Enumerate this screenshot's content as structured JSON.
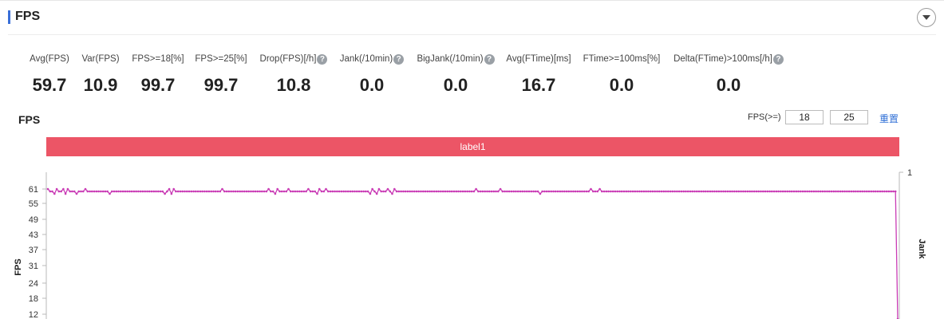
{
  "section": {
    "title": "FPS"
  },
  "stats": [
    {
      "label": "Avg(FPS)",
      "value": "59.7",
      "help": false
    },
    {
      "label": "Var(FPS)",
      "value": "10.9",
      "help": false
    },
    {
      "label": "FPS>=18[%]",
      "value": "99.7",
      "help": false
    },
    {
      "label": "FPS>=25[%]",
      "value": "99.7",
      "help": false
    },
    {
      "label": "Drop(FPS)[/h]",
      "value": "10.8",
      "help": true
    },
    {
      "label": "Jank(/10min)",
      "value": "0.0",
      "help": true
    },
    {
      "label": "BigJank(/10min)",
      "value": "0.0",
      "help": true
    },
    {
      "label": "Avg(FTime)[ms]",
      "value": "16.7",
      "help": false
    },
    {
      "label": "FTime>=100ms[%]",
      "value": "0.0",
      "help": false
    },
    {
      "label": "Delta(FTime)>100ms[/h]",
      "value": "0.0",
      "help": true
    }
  ],
  "help_glyph": "?",
  "chart_panel": {
    "title": "FPS",
    "threshold_label": "FPS(>=)",
    "threshold_low": "18",
    "threshold_high": "25",
    "reset_label": "重置",
    "label_bar_text": "label1",
    "label_bar_color": "#ec5566"
  },
  "chart_data": {
    "type": "line",
    "ylabel": "FPS",
    "y2label": "Jank",
    "y_ticks": [
      "61",
      "55",
      "49",
      "43",
      "37",
      "31",
      "24",
      "18",
      "12"
    ],
    "y2_ticks": [
      "1"
    ],
    "series": [
      {
        "name": "FPS",
        "color": "#c93bb5",
        "values": [
          61,
          60,
          60,
          59,
          61,
          60,
          60,
          61,
          59,
          61,
          60,
          60,
          60,
          59,
          60,
          60,
          60,
          61,
          60,
          60,
          60,
          60,
          60,
          60,
          60,
          60,
          60,
          60,
          59,
          60,
          60,
          60,
          60,
          60,
          60,
          60,
          60,
          60,
          60,
          60,
          60,
          60,
          60,
          60,
          60,
          60,
          60,
          60,
          60,
          60,
          60,
          60,
          60,
          59,
          60,
          61,
          59,
          61,
          60,
          60,
          60,
          60,
          60,
          60,
          60,
          60,
          60,
          60,
          60,
          60,
          60,
          60,
          60,
          60,
          60,
          60,
          60,
          60,
          60,
          61,
          60,
          60,
          60,
          60,
          60,
          60,
          60,
          60,
          60,
          60,
          60,
          60,
          60,
          60,
          60,
          60,
          60,
          60,
          60,
          60,
          61,
          60,
          60,
          59,
          61,
          60,
          60,
          60,
          60,
          61,
          60,
          60,
          60,
          60,
          60,
          60,
          60,
          60,
          61,
          60,
          60,
          60,
          59,
          61,
          60,
          60,
          61,
          60,
          60,
          60,
          60,
          60,
          60,
          60,
          60,
          60,
          60,
          60,
          60,
          60,
          60,
          60,
          60,
          60,
          60,
          60,
          59,
          61,
          60,
          59,
          61,
          60,
          60,
          60,
          61,
          60,
          59,
          61,
          60,
          60,
          60,
          60,
          60,
          60,
          60,
          60,
          60,
          60,
          60,
          60,
          60,
          60,
          60,
          60,
          60,
          60,
          60,
          60,
          60,
          60,
          60,
          60,
          60,
          60,
          60,
          60,
          60,
          60,
          60,
          60,
          60,
          60,
          60,
          60,
          61,
          60,
          60,
          60,
          60,
          60,
          60,
          60,
          60,
          60,
          60,
          61,
          60,
          60,
          60,
          60,
          60,
          60,
          60,
          60,
          60,
          60,
          60,
          60,
          60,
          60,
          60,
          60,
          60,
          59,
          60,
          60,
          60,
          60,
          60,
          60,
          60,
          60,
          60,
          60,
          60,
          60,
          60,
          60,
          60,
          60,
          60,
          60,
          60,
          60,
          60,
          60,
          61,
          60,
          60,
          60,
          61,
          60,
          60,
          60,
          60,
          60,
          60,
          60,
          60,
          60,
          60,
          60,
          60,
          60,
          60,
          60,
          60,
          60,
          60,
          60,
          60,
          60,
          60,
          60,
          60,
          60,
          60,
          60,
          60,
          60,
          60,
          60,
          60,
          60,
          60,
          60,
          60,
          60,
          60,
          60,
          60,
          60,
          60,
          60,
          60,
          60,
          60,
          60,
          60,
          60,
          60,
          60,
          60,
          60,
          60,
          60,
          60,
          60,
          60,
          60,
          60,
          60,
          60,
          60,
          60,
          60,
          60,
          60,
          60,
          60,
          60,
          60,
          60,
          60,
          60,
          60,
          60,
          60,
          60,
          60,
          60,
          60,
          60,
          60,
          60,
          60,
          60,
          60,
          60,
          60,
          60,
          60,
          60,
          60,
          60,
          60,
          60,
          60,
          60,
          60,
          60,
          60,
          60,
          60,
          60,
          60,
          60,
          60,
          60,
          60,
          60,
          60,
          60,
          60,
          60,
          60,
          60,
          60,
          60,
          60,
          60,
          60,
          60,
          60,
          60,
          60,
          60,
          60,
          60,
          60,
          60,
          60,
          60,
          60,
          60,
          0
        ]
      }
    ]
  }
}
